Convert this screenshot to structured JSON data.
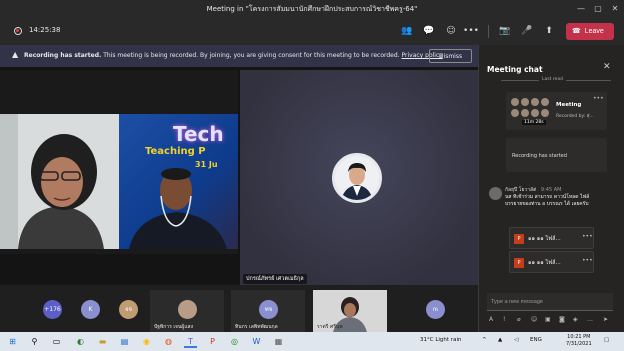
{
  "window": {
    "title": "Meeting in \"โครงการสัมมนานักศึกษาฝึกประสบการณ์วิชาชีพครู-64\""
  },
  "toolbar": {
    "timer": "14:25:38",
    "leave_label": "Leave"
  },
  "banner": {
    "title": "Recording has started.",
    "message": "This meeting is being recorded. By joining, you are giving consent for this meeting to be recorded.",
    "link": "Privacy policy",
    "dismiss_label": "Dismiss"
  },
  "stage": {
    "shared_text_1": "Tech",
    "shared_text_2": "Teaching P",
    "shared_text_3": "31 Ju",
    "active_speaker": "ปกรณ์ภัทรย์ เศวตเมธิกุล"
  },
  "participants": [
    {
      "initials": "+176",
      "color": "#5b5fc7"
    },
    {
      "initials": "K",
      "color": "#8a8fd0"
    },
    {
      "initials": "จจ",
      "color": "#c19c73"
    },
    {
      "name": "ปัฐพิการ เจนผู้แสง"
    },
    {
      "initials": "ทจ",
      "color": "#8a8fd0",
      "name": "ทินกร เลพิทพัฒนกุล"
    },
    {
      "name": "ราตรี ศรีนุพ"
    },
    {
      "initials": "กเ",
      "color": "#8a8fd0"
    }
  ],
  "chat": {
    "title": "Meeting chat",
    "last_read": "Last read",
    "meeting_card": {
      "title": "Meeting",
      "subtitle": "Recorded by: สุ่...",
      "duration": "11m 28s"
    },
    "system_message": "Recording has started",
    "message": {
      "author": "กัลยุปี โยวาลัต่",
      "time": "9:45 AM",
      "body": "นส ทิเช้าร่วม สามารถ ดาวน์โหลด ไฟล์ บรรยายของท่าน อ บรรณร ได้ เลยครับ"
    },
    "files": [
      "๑๑ ๑๑ ไฟล์...",
      "๑๑ ๑๑ ไฟล์..."
    ],
    "compose_placeholder": "Type a new message"
  },
  "taskbar": {
    "weather": "31°C  Light rain",
    "lang": "ENG",
    "time": "10:21 PM",
    "date": "7/31/2021"
  }
}
